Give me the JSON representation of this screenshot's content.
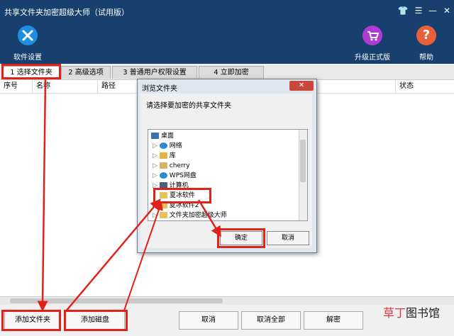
{
  "window": {
    "title": "共享文件夹加密超级大师（试用版）"
  },
  "header": {
    "settings_label": "软件设置",
    "upgrade_label": "升级正式版",
    "help_label": "帮助",
    "help_glyph": "?"
  },
  "tabs": [
    {
      "label": "1 选择文件夹"
    },
    {
      "label": "2 高级选项"
    },
    {
      "label": "3 普通用户权限设置"
    },
    {
      "label": "4 立即加密"
    }
  ],
  "table": {
    "headers": [
      "序号",
      "名称",
      "路径",
      "状态"
    ]
  },
  "buttons": {
    "add_folder": "添加文件夹",
    "add_disk": "添加磁盘",
    "cancel": "取消",
    "cancel_all": "取消全部",
    "decrypt": "解密"
  },
  "dialog": {
    "title": "浏览文件夹",
    "prompt": "请选择要加密的共享文件夹",
    "ok": "确定",
    "cancel": "取消",
    "tree": [
      "桌面",
      "网络",
      "库",
      "cherry",
      "WPS网盘",
      "计算机",
      "夏冰软件",
      "夏冰软件2",
      "文件夹加密超级大师"
    ]
  },
  "watermark": {
    "part1": "草丁",
    "part2": "图书馆"
  },
  "colors": {
    "titlebar": "#17406e",
    "highlight": "#e0221a"
  }
}
